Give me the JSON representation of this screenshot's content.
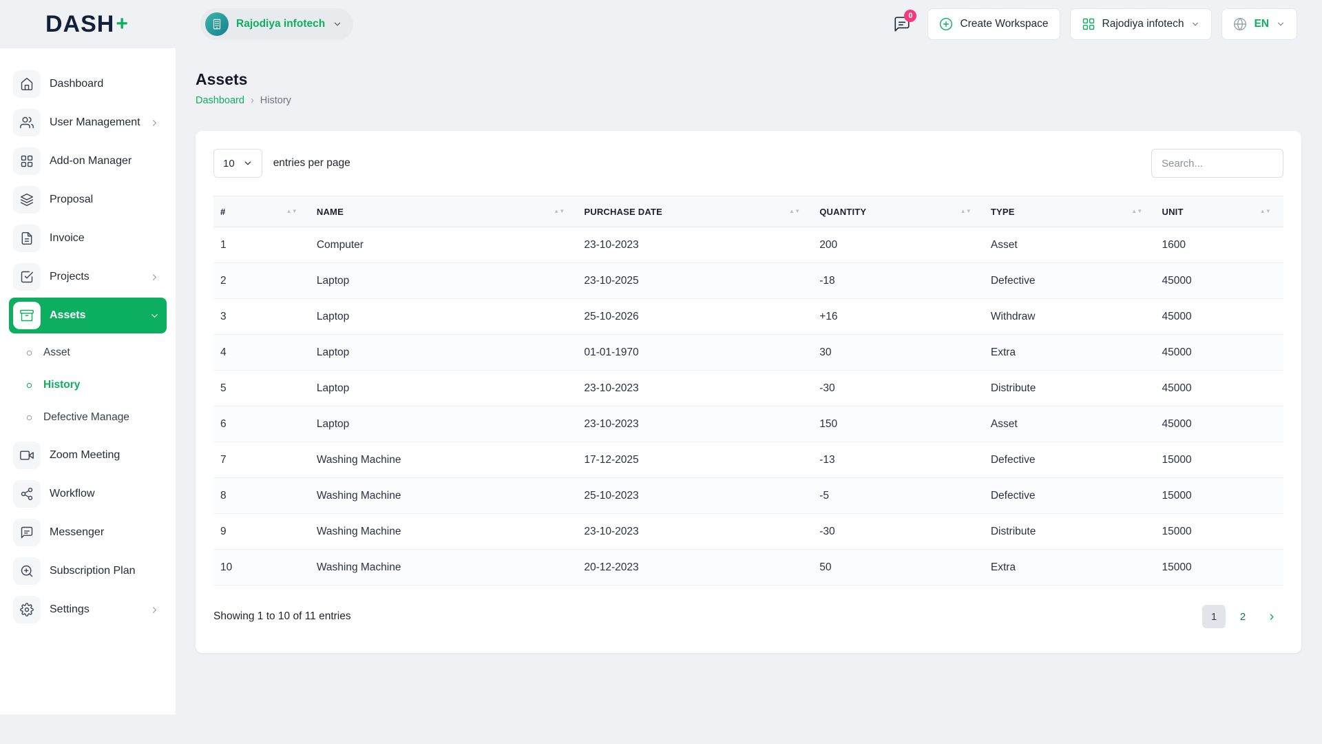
{
  "brand": {
    "name": "DASH",
    "plus": "+"
  },
  "topbar": {
    "workspace_name": "Rajodiya infotech",
    "messages_badge": "0",
    "create_workspace_label": "Create Workspace",
    "company_name": "Rajodiya infotech",
    "language": "EN"
  },
  "sidebar": {
    "dashboard": "Dashboard",
    "user_management": "User Management",
    "addon_manager": "Add-on Manager",
    "proposal": "Proposal",
    "invoice": "Invoice",
    "projects": "Projects",
    "assets": "Assets",
    "assets_sub": {
      "asset": "Asset",
      "history": "History",
      "defective": "Defective Manage"
    },
    "zoom_meeting": "Zoom Meeting",
    "workflow": "Workflow",
    "messenger": "Messenger",
    "subscription_plan": "Subscription Plan",
    "settings": "Settings"
  },
  "page": {
    "title": "Assets",
    "breadcrumb": {
      "home": "Dashboard",
      "separator": "›",
      "current": "History"
    }
  },
  "controls": {
    "entries_value": "10",
    "entries_label": "entries per page",
    "search_placeholder": "Search..."
  },
  "table": {
    "columns": [
      "#",
      "NAME",
      "PURCHASE DATE",
      "QUANTITY",
      "TYPE",
      "UNIT"
    ],
    "rows": [
      [
        "1",
        "Computer",
        "23-10-2023",
        "200",
        "Asset",
        "1600"
      ],
      [
        "2",
        "Laptop",
        "23-10-2025",
        "-18",
        "Defective",
        "45000"
      ],
      [
        "3",
        "Laptop",
        "25-10-2026",
        "+16",
        "Withdraw",
        "45000"
      ],
      [
        "4",
        "Laptop",
        "01-01-1970",
        "30",
        "Extra",
        "45000"
      ],
      [
        "5",
        "Laptop",
        "23-10-2023",
        "-30",
        "Distribute",
        "45000"
      ],
      [
        "6",
        "Laptop",
        "23-10-2023",
        "150",
        "Asset",
        "45000"
      ],
      [
        "7",
        "Washing Machine",
        "17-12-2025",
        "-13",
        "Defective",
        "15000"
      ],
      [
        "8",
        "Washing Machine",
        "25-10-2023",
        "-5",
        "Defective",
        "15000"
      ],
      [
        "9",
        "Washing Machine",
        "23-10-2023",
        "-30",
        "Distribute",
        "15000"
      ],
      [
        "10",
        "Washing Machine",
        "20-12-2023",
        "50",
        "Extra",
        "15000"
      ]
    ]
  },
  "footer": {
    "summary": "Showing 1 to 10 of 11 entries",
    "pages": [
      "1",
      "2"
    ],
    "next": "›"
  },
  "colors": {
    "accent": "#0caf60",
    "badge": "#f5397c"
  }
}
